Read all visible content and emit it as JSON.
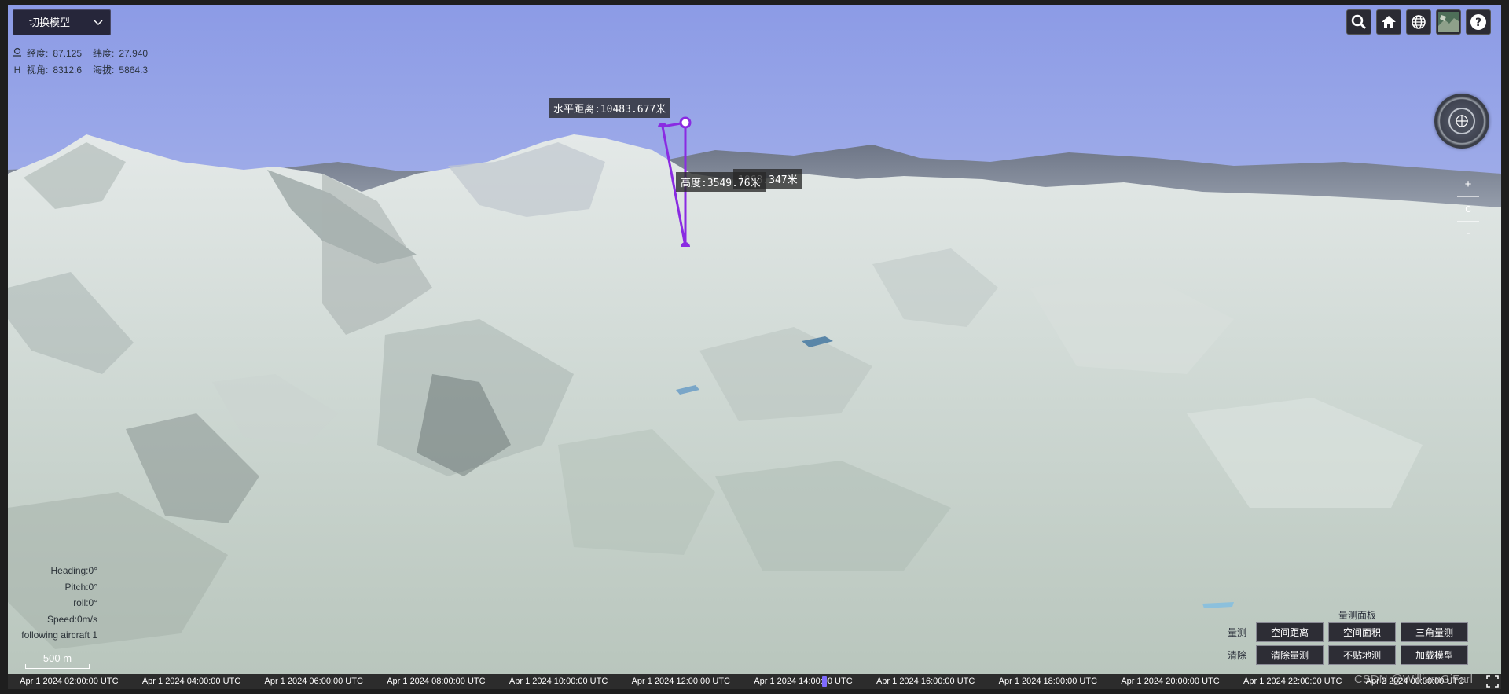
{
  "model_switch": {
    "label": "切换模型"
  },
  "coords": {
    "lon_label": "经度:",
    "lon_value": "87.125",
    "lat_label": "纬度:",
    "lat_value": "27.940",
    "view_label": "视角:",
    "view_value": "8312.6",
    "alt_label": "海拔:",
    "alt_value": "5864.3",
    "alt_prefix": "H"
  },
  "toolbar": {
    "icons": [
      "search-icon",
      "home-icon",
      "globe-icon",
      "basemap-icon",
      "help-icon"
    ]
  },
  "zoom": {
    "in": "+",
    "reset": "c",
    "out": "-"
  },
  "measurements": {
    "horizontal": "水平距离:10483.677米",
    "height": "高度:3549.76米",
    "space": "1068.347米",
    "line_color": "#8a2be2"
  },
  "camera": {
    "heading": "Heading:0°",
    "pitch": "Pitch:0°",
    "roll": "roll:0°",
    "speed": "Speed:0m/s",
    "follow": "following aircraft 1"
  },
  "scale": {
    "label": "500 m"
  },
  "measure_panel": {
    "title": "量测面板",
    "row1_label": "量测",
    "row2_label": "清除",
    "buttons_row1": [
      "空间距离",
      "空间面积",
      "三角量测"
    ],
    "buttons_row2": [
      "清除量测",
      "不贴地测",
      "加载模型"
    ]
  },
  "timeline": {
    "ticks": [
      "Apr 1 2024 02:00:00 UTC",
      "Apr 1 2024 04:00:00 UTC",
      "Apr 1 2024 06:00:00 UTC",
      "Apr 1 2024 08:00:00 UTC",
      "Apr 1 2024 10:00:00 UTC",
      "Apr 1 2024 12:00:00 UTC",
      "Apr 1 2024 14:00:00 UTC",
      "Apr 1 2024 16:00:00 UTC",
      "Apr 1 2024 18:00:00 UTC",
      "Apr 1 2024 20:00:00 UTC",
      "Apr 1 2024 22:00:00 UTC",
      "Apr 2 2024 00:00:00 UTC"
    ]
  },
  "watermark": "CSDN @WilliamGiFarl"
}
